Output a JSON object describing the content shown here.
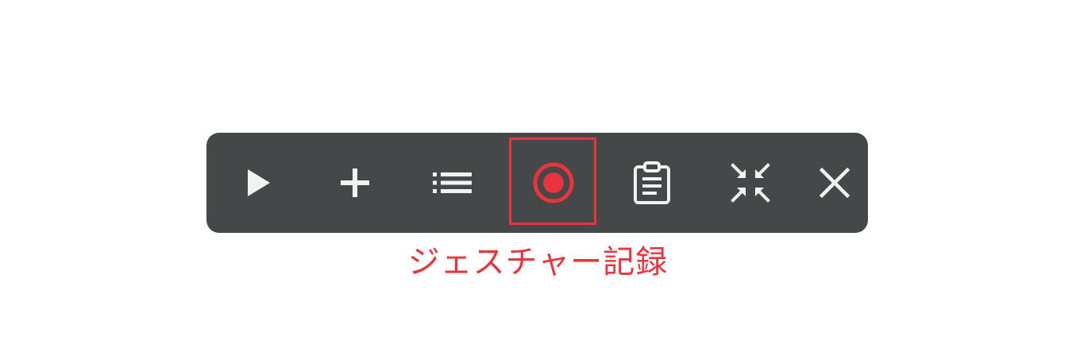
{
  "toolbar": {
    "buttons": [
      {
        "name": "play-button",
        "icon": "play-icon"
      },
      {
        "name": "add-button",
        "icon": "plus-icon"
      },
      {
        "name": "list-button",
        "icon": "list-icon"
      },
      {
        "name": "record-gesture-button",
        "icon": "record-icon",
        "highlighted": true
      },
      {
        "name": "clipboard-button",
        "icon": "clipboard-icon"
      },
      {
        "name": "collapse-button",
        "icon": "collapse-arrows-icon"
      },
      {
        "name": "close-button",
        "icon": "close-icon"
      }
    ]
  },
  "annotation": {
    "label": "ジェスチャー記録"
  },
  "colors": {
    "toolbar_bg": "#444849",
    "icon": "#f2f2f2",
    "accent": "#e8343a",
    "caption": "#e8343a"
  }
}
